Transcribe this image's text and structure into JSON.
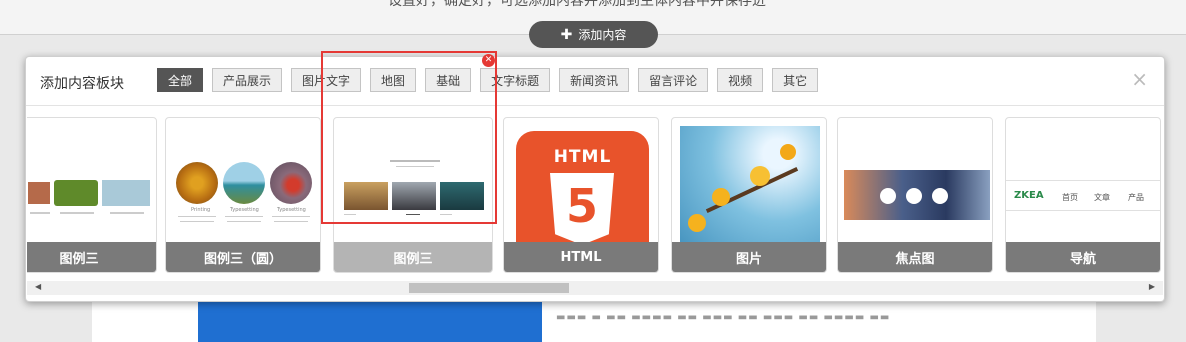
{
  "background": {
    "top_text": "设置好，确定好，可选添加内容并添加到主体内容中并保存进"
  },
  "add_button": {
    "icon": "plus-icon",
    "label": "添加内容"
  },
  "panel": {
    "title": "添加内容板块",
    "tabs": [
      {
        "label": "全部",
        "active": true
      },
      {
        "label": "产品展示"
      },
      {
        "label": "图片文字"
      },
      {
        "label": "地图"
      },
      {
        "label": "基础"
      },
      {
        "label": "文字标题"
      },
      {
        "label": "新闻资讯"
      },
      {
        "label": "留言评论"
      },
      {
        "label": "视频"
      },
      {
        "label": "其它"
      }
    ],
    "close": "×"
  },
  "cards": [
    {
      "label": "图例三"
    },
    {
      "label": "图例三（圆）",
      "thumb_titles": [
        "Printing",
        "Typesetting",
        "Typesetting"
      ]
    },
    {
      "label": "图例三",
      "selected": true
    },
    {
      "label": "HTML",
      "badge_text": "HTML",
      "badge_number": "5"
    },
    {
      "label": "图片"
    },
    {
      "label": "焦点图"
    },
    {
      "label": "导航",
      "logo": "ZKEA",
      "nav_items": [
        "首页",
        "文章",
        "产品"
      ]
    }
  ],
  "colors": {
    "accent_red": "#e53935",
    "html5_orange": "#e8532b",
    "label_gray": "#7a7a7a"
  }
}
